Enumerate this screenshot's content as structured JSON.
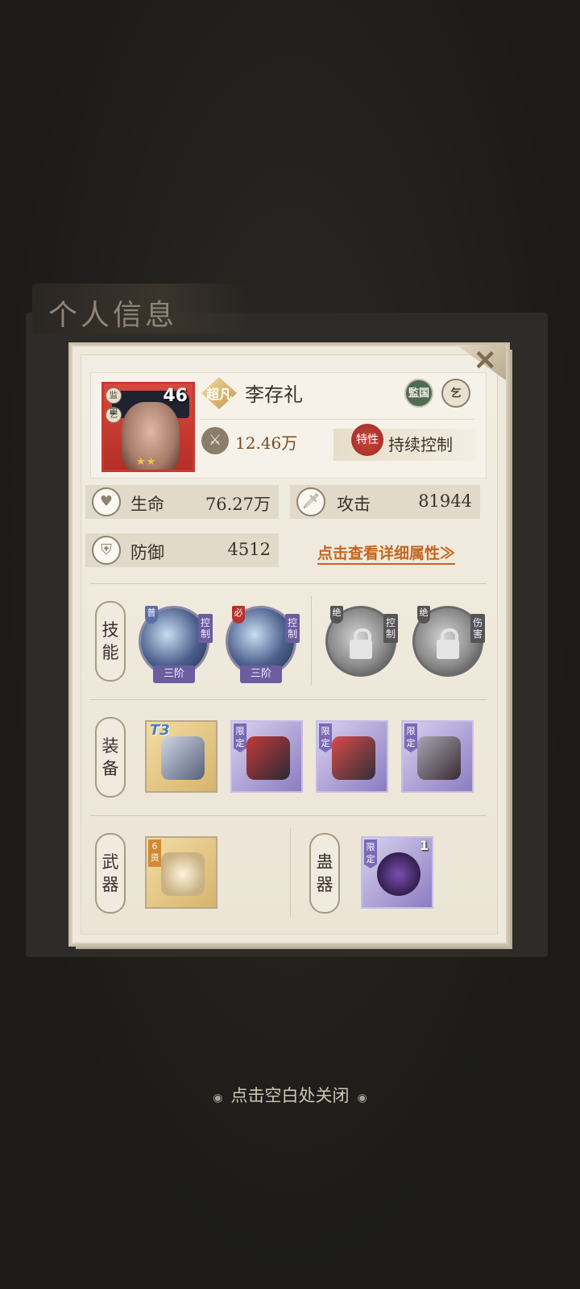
{
  "background": {
    "title": "个人信息"
  },
  "hero": {
    "level": "46",
    "rank_label": "超凡",
    "name": "李存礼",
    "portrait_badges": [
      "监国",
      "乞"
    ],
    "stars": "★★",
    "faction_badges": [
      "監国",
      "乞"
    ],
    "power": "12.46万",
    "trait_seal": "特性",
    "trait": "持续控制"
  },
  "stats": {
    "hp_label": "生命",
    "hp_value": "76.27万",
    "atk_label": "攻击",
    "atk_value": "81944",
    "def_label": "防御",
    "def_value": "4512",
    "detail_link": "点击查看详细属性≫"
  },
  "sections": {
    "skills": [
      "技",
      "能"
    ],
    "equipment": [
      "装",
      "备"
    ],
    "weapon": [
      "武",
      "器"
    ],
    "gu": [
      "蛊",
      "器"
    ]
  },
  "skills": [
    {
      "corner": "普",
      "tag": "控制",
      "tier": "三阶",
      "locked": false
    },
    {
      "corner": "必",
      "tag": "控制",
      "tier": "三阶",
      "locked": false
    },
    {
      "corner": "绝",
      "tag": "控制",
      "tier": "",
      "locked": true
    },
    {
      "corner": "绝",
      "tag": "伤害",
      "tier": "",
      "locked": true
    }
  ],
  "equipment": [
    {
      "badge": "T3",
      "type": "boots-icon",
      "rarity": "gold"
    },
    {
      "badge": "限定",
      "type": "armor-icon",
      "rarity": "purple"
    },
    {
      "badge": "限定",
      "type": "bracer-icon",
      "rarity": "purple"
    },
    {
      "badge": "限定",
      "type": "helmet-icon",
      "rarity": "purple"
    }
  ],
  "weapon": {
    "badge": "6资",
    "type": "weapon-icon"
  },
  "gu": {
    "badge": "限定",
    "count": "1",
    "type": "gourd-icon"
  },
  "close_hint": "点击空白处关闭"
}
